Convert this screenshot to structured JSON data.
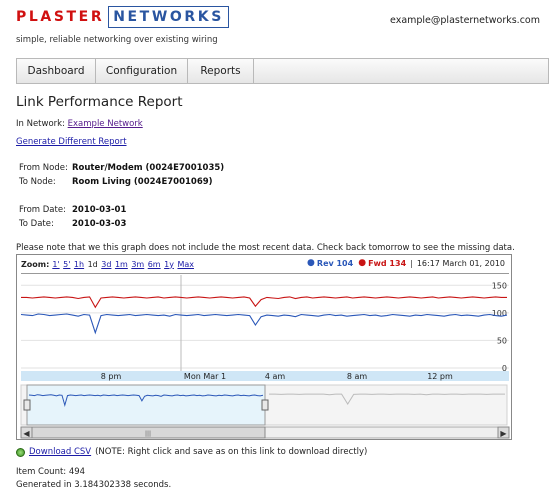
{
  "brand": {
    "word1": "PLASTER",
    "word2": "NETWORKS",
    "tagline": "simple, reliable networking over existing wiring"
  },
  "user": {
    "email": "example@plasternetworks.com"
  },
  "nav": {
    "tabs": [
      "Dashboard",
      "Configuration",
      "Reports"
    ]
  },
  "page": {
    "title": "Link Performance Report",
    "in_network_label": "In Network:",
    "network_link": "Example Network",
    "generate_link": "Generate Different Report"
  },
  "nodes": {
    "from_label": "From Node:",
    "from_value": "Router/Modem (0024E7001035)",
    "to_label": "To Node:",
    "to_value": "Room Living (0024E7001069)"
  },
  "dates": {
    "from_label": "From Date:",
    "from_value": "2010-03-01",
    "to_label": "To Date:",
    "to_value": "2010-03-03"
  },
  "note": "Please note that we this graph does not include the most recent data. Check back tomorrow to see the missing data.",
  "chart": {
    "zoom_label": "Zoom:",
    "zoom_options": [
      "1'",
      "5'",
      "1h",
      "1d",
      "3d",
      "1m",
      "3m",
      "6m",
      "1y",
      "Max"
    ],
    "zoom_selected": "1d",
    "legend_rev": "Rev 104",
    "legend_fwd": "Fwd 134",
    "timestamp": "16:17 March 01, 2010",
    "colors": {
      "rev": "#2a57b8",
      "fwd": "#c81414",
      "nav_fill": "#e6f4fb"
    }
  },
  "chart_data": {
    "type": "line",
    "x_ticks": [
      "8 pm",
      "Mon Mar 1",
      "4 am",
      "8 am",
      "12 pm"
    ],
    "y_ticks": [
      0,
      50,
      100,
      150
    ],
    "ylim": [
      0,
      165
    ],
    "grid": true,
    "series": [
      {
        "name": "Rev",
        "values": [
          97,
          96,
          95,
          98,
          97,
          95,
          96,
          97,
          98,
          96,
          94,
          97,
          96,
          64,
          95,
          97,
          96,
          95,
          96,
          97,
          95,
          96,
          97,
          96,
          95,
          96,
          94,
          97,
          96,
          95,
          96,
          97,
          95,
          96,
          97,
          96,
          95,
          96,
          97,
          96,
          95,
          78,
          93,
          96,
          95,
          94,
          96,
          95,
          93,
          97,
          96,
          95,
          94,
          96,
          97,
          95,
          96,
          94,
          95,
          96,
          97,
          95,
          96,
          94,
          95,
          97,
          96,
          95,
          94,
          96,
          95,
          97,
          96,
          95,
          94,
          96,
          97,
          95,
          96,
          95,
          94,
          96,
          97,
          95,
          94,
          96
        ]
      },
      {
        "name": "Fwd",
        "values": [
          128,
          128,
          127,
          128,
          129,
          128,
          127,
          128,
          129,
          128,
          126,
          128,
          129,
          110,
          127,
          128,
          129,
          128,
          127,
          128,
          129,
          128,
          127,
          128,
          129,
          127,
          128,
          129,
          128,
          127,
          128,
          129,
          128,
          127,
          128,
          129,
          128,
          127,
          128,
          129,
          127,
          112,
          124,
          128,
          127,
          126,
          128,
          129,
          126,
          128,
          129,
          127,
          128,
          129,
          128,
          127,
          128,
          129,
          127,
          128,
          129,
          128,
          127,
          128,
          129,
          128,
          127,
          128,
          129,
          128,
          127,
          128,
          129,
          127,
          128,
          129,
          128,
          127,
          128,
          129,
          128,
          127,
          128,
          129,
          128,
          128
        ]
      }
    ]
  },
  "footer": {
    "csv_link": "Download CSV",
    "csv_note": "(NOTE: Right click and save as on this link to download directly)",
    "item_count": "Item Count: 494",
    "generated": "Generated in 3.184302338 seconds."
  }
}
